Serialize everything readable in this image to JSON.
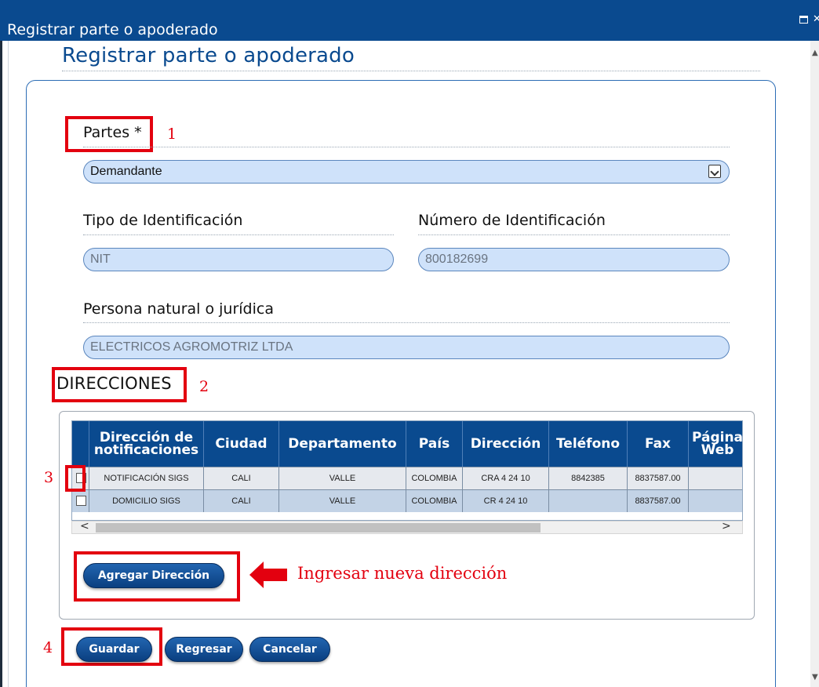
{
  "window": {
    "title": "Registrar parte o apoderado"
  },
  "page": {
    "title": "Registrar parte o apoderado"
  },
  "form": {
    "partes_label": "Partes *",
    "partes_value": "Demandante",
    "tipo_id_label": "Tipo de Identificación",
    "tipo_id_value": "NIT",
    "numero_id_label": "Número de Identificación",
    "numero_id_value": "800182699",
    "persona_label": "Persona natural o jurídica",
    "persona_value": "ELECTRICOS AGROMOTRIZ LTDA"
  },
  "direcciones": {
    "heading": "DIRECCIONES",
    "columns": [
      "Dirección de notificaciones",
      "Ciudad",
      "Departamento",
      "País",
      "Dirección",
      "Teléfono",
      "Fax",
      "Página Web"
    ],
    "rows": [
      {
        "checked": false,
        "cells": [
          "NOTIFICACIÓN SIGS",
          "CALI",
          "VALLE",
          "COLOMBIA",
          "CRA 4 24 10",
          "8842385",
          "8837587.00",
          ""
        ]
      },
      {
        "checked": false,
        "cells": [
          "DOMICILIO SIGS",
          "CALI",
          "VALLE",
          "COLOMBIA",
          "CR 4 24 10",
          "",
          "8837587.00",
          ""
        ]
      }
    ],
    "add_button": "Agregar Dirección"
  },
  "annotations": {
    "n1": "1",
    "n2": "2",
    "n3": "3",
    "n4": "4",
    "arrow_text": "Ingresar nueva dirección",
    "color": "#e3000f"
  },
  "actions": {
    "save": "Guardar",
    "back": "Regresar",
    "cancel": "Cancelar"
  },
  "colors": {
    "titlebar": "#0a4a8f",
    "heading": "#0a4a8f",
    "input_fill": "#cfe2fa",
    "grid_header": "#0a4a8f"
  }
}
